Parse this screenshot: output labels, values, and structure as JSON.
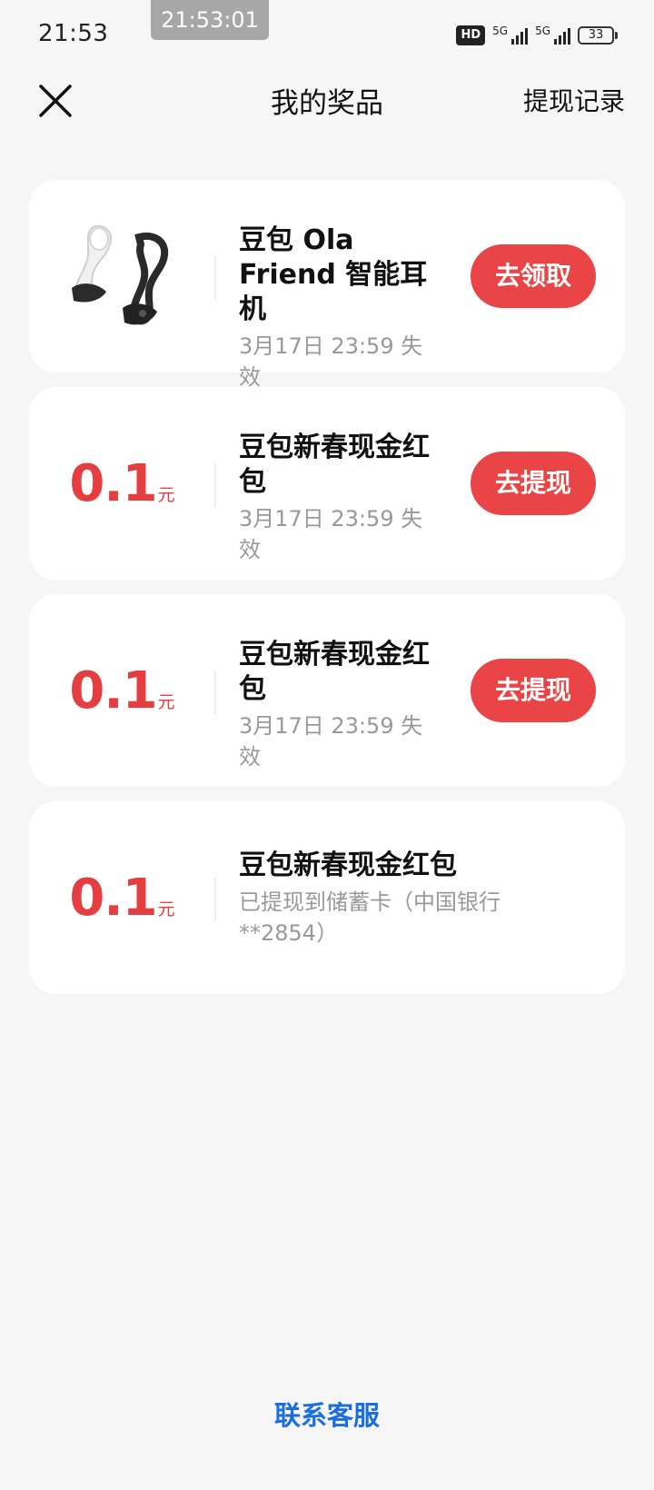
{
  "status_bar": {
    "time": "21:53",
    "overlay_time": "21:53:01",
    "hd_badge": "HD",
    "network_1": "5G",
    "network_2": "5G",
    "battery": "33"
  },
  "header": {
    "close_icon": "close-icon",
    "title": "我的奖品",
    "records_link": "提现记录"
  },
  "prizes": [
    {
      "image": "earphone-product-image",
      "title": "豆包 Ola Friend 智能耳机",
      "subtitle": "3月17日 23:59 失效",
      "button": "去领取"
    },
    {
      "amount": "0.1",
      "unit": "元",
      "title": "豆包新春现金红包",
      "subtitle": "3月17日 23:59 失效",
      "button": "去提现"
    },
    {
      "amount": "0.1",
      "unit": "元",
      "title": "豆包新春现金红包",
      "subtitle": "3月17日 23:59 失效",
      "button": "去提现"
    },
    {
      "amount": "0.1",
      "unit": "元",
      "title": "豆包新春现金红包",
      "subtitle": "已提现到储蓄卡（中国银行**2854）"
    }
  ],
  "footer": {
    "contact": "联系客服"
  },
  "colors": {
    "accent_red": "#e94547",
    "amount_red": "#e43e40",
    "link_blue": "#1a6fe0",
    "background": "#f6f6f6"
  }
}
